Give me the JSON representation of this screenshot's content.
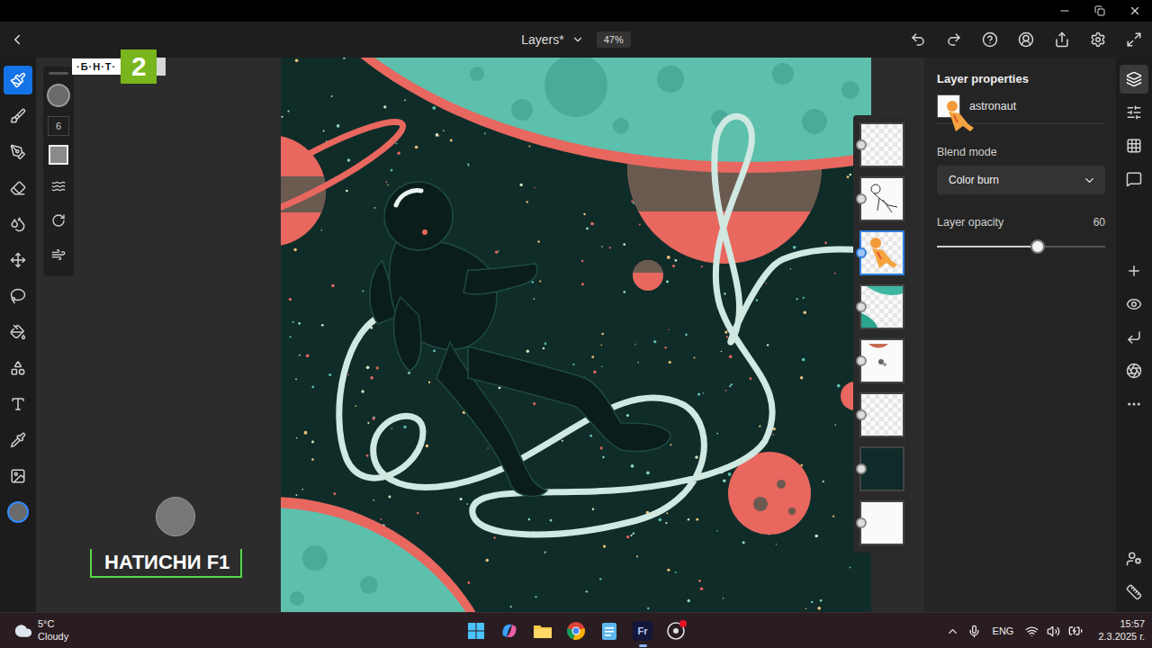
{
  "header": {
    "title": "Layers*",
    "zoom": "47%"
  },
  "tools": [
    {
      "selected": true
    },
    {
      "selected": false
    },
    {
      "selected": false
    },
    {
      "selected": false
    },
    {
      "selected": false
    },
    {
      "selected": false
    },
    {
      "selected": false
    },
    {
      "selected": false
    },
    {
      "selected": false
    },
    {
      "selected": false
    },
    {
      "selected": false
    },
    {
      "selected": false
    },
    {
      "selected": false
    }
  ],
  "tool_options": {
    "size": "6"
  },
  "layers": [
    {
      "kind": "empty",
      "selected": false
    },
    {
      "kind": "sketch",
      "selected": false
    },
    {
      "kind": "color",
      "selected": true
    },
    {
      "kind": "planet",
      "selected": false
    },
    {
      "kind": "objects",
      "selected": false
    },
    {
      "kind": "empty",
      "selected": false
    },
    {
      "kind": "fill",
      "selected": false
    },
    {
      "kind": "paper",
      "selected": false
    }
  ],
  "properties": {
    "title": "Layer properties",
    "layer_name": "astronaut",
    "blend_label": "Blend mode",
    "blend_value": "Color burn",
    "opacity_label": "Layer opacity",
    "opacity_value": "60",
    "opacity_level": 0.6
  },
  "side_icons": [
    {
      "selected": true
    },
    {
      "selected": false
    },
    {
      "selected": false
    },
    {
      "selected": false
    },
    {
      "selected": false
    },
    {
      "selected": false
    },
    {
      "selected": false
    },
    {
      "selected": false
    },
    {
      "selected": false
    },
    {
      "selected": false
    },
    {
      "selected": false
    }
  ],
  "taskbar": {
    "temperature": "5°C",
    "weather": "Cloudy",
    "apps": [
      {
        "active": false
      },
      {
        "active": false
      },
      {
        "active": false
      },
      {
        "active": false
      },
      {
        "active": false
      },
      {
        "active": true,
        "label": "Fr"
      },
      {
        "active": false,
        "badge": true
      }
    ],
    "language": "ENG",
    "time": "15:57",
    "date": "2.3.2025 г."
  },
  "overlays": {
    "channel_logo": "·Б·Н·Т·",
    "channel_number": "2",
    "banner": "НАТИСНИ F1"
  }
}
